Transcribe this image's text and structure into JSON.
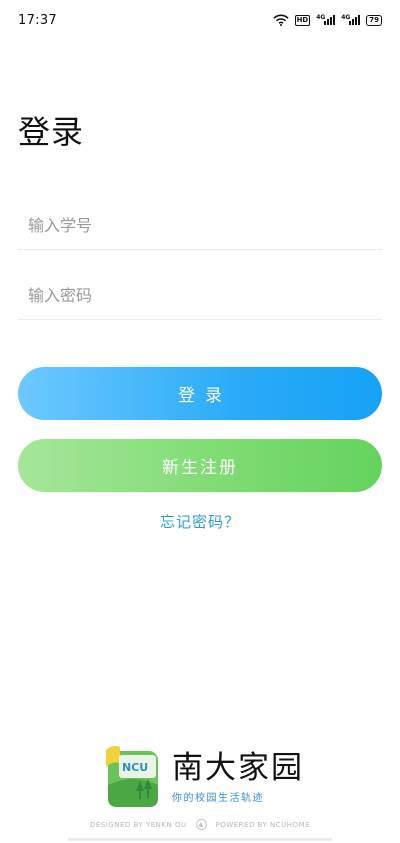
{
  "status_bar": {
    "time": "17:37",
    "icons": [
      "wifi-icon",
      "hd-icon",
      "signal-4g-icon",
      "signal-4g-icon",
      "battery-icon"
    ],
    "hd_label": "HD",
    "signal_tag": "4G",
    "battery_level": "79"
  },
  "login": {
    "title": "登录",
    "student_id_placeholder": "输入学号",
    "password_placeholder": "输入密码",
    "login_button": "登录",
    "register_button": "新生注册",
    "forgot_password": "忘记密码？"
  },
  "brand": {
    "logo_text": "NCU",
    "name": "南大家园",
    "slogan": "你的校园生活轨迹",
    "designed_by": "DESIGNED BY YENKN OU",
    "powered_by": "POWERED BY NCUHOME"
  },
  "colors": {
    "login_gradient": [
      "#6ec9ff",
      "#16a2f5"
    ],
    "register_gradient": [
      "#a6e69a",
      "#64d35d"
    ],
    "link": "#2e9de0",
    "slogan": "#2f8fd0"
  }
}
